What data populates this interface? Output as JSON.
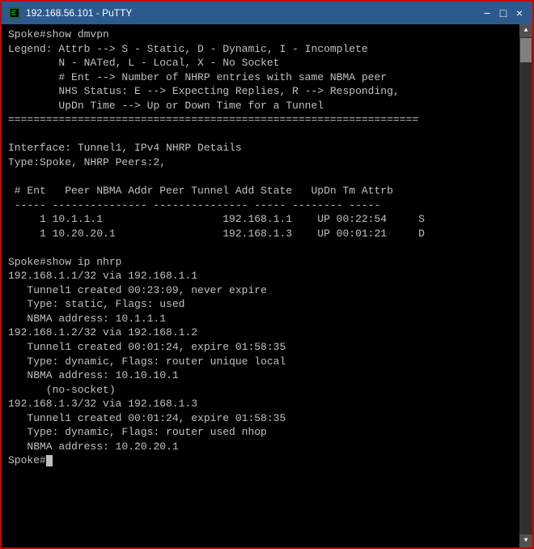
{
  "window": {
    "title": "192.168.56.101 - PuTTY",
    "icon": "putty-icon"
  },
  "titlebar": {
    "minimize_label": "−",
    "maximize_label": "□",
    "close_label": "×"
  },
  "terminal": {
    "lines": [
      "Spoke#show dmvpn",
      "Legend: Attrb --> S - Static, D - Dynamic, I - Incomplete",
      "        N - NATed, L - Local, X - No Socket",
      "        # Ent --> Number of NHRP entries with same NBMA peer",
      "        NHS Status: E --> Expecting Replies, R --> Responding,",
      "        UpDn Time --> Up or Down Time for a Tunnel",
      "=================================================================",
      "",
      "Interface: Tunnel1, IPv4 NHRP Details",
      "Type:Spoke, NHRP Peers:2,",
      "",
      " # Ent   Peer NBMA Addr Peer Tunnel Add State   UpDn Tm Attrb",
      " ----- --------------- --------------- ----- -------- -----",
      "     1 10.1.1.1                   192.168.1.1    UP 00:22:54     S",
      "     1 10.20.20.1                 192.168.1.3    UP 00:01:21     D",
      "",
      "Spoke#show ip nhrp",
      "192.168.1.1/32 via 192.168.1.1",
      "   Tunnel1 created 00:23:09, never expire",
      "   Type: static, Flags: used",
      "   NBMA address: 10.1.1.1",
      "192.168.1.2/32 via 192.168.1.2",
      "   Tunnel1 created 00:01:24, expire 01:58:35",
      "   Type: dynamic, Flags: router unique local",
      "   NBMA address: 10.10.10.1",
      "      (no-socket)",
      "192.168.1.3/32 via 192.168.1.3",
      "   Tunnel1 created 00:01:24, expire 01:58:35",
      "   Type: dynamic, Flags: router used nhop",
      "   NBMA address: 10.20.20.1",
      "Spoke#"
    ]
  }
}
